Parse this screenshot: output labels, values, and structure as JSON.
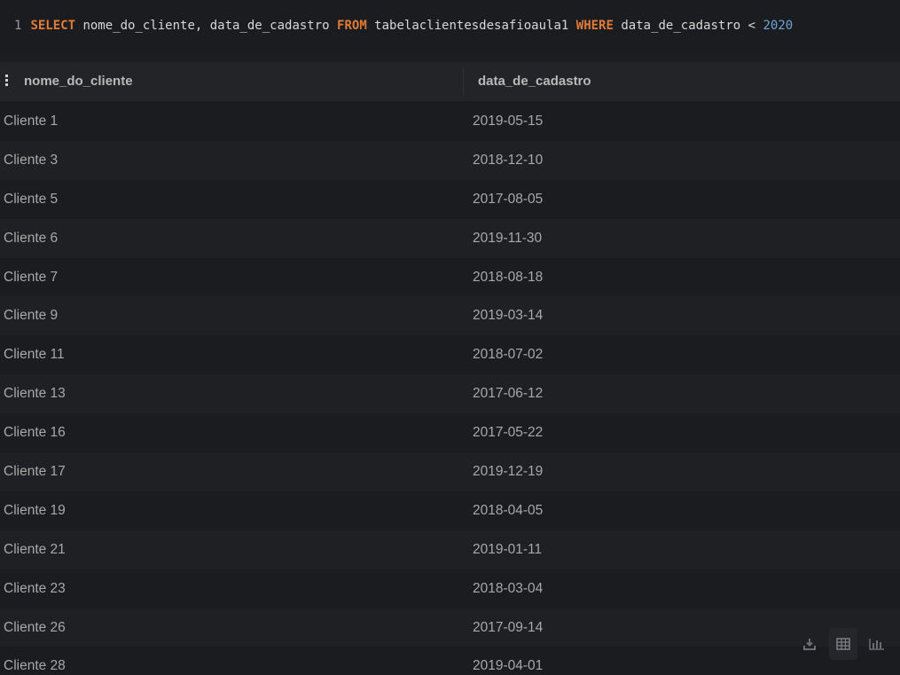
{
  "editor": {
    "line_number": "1",
    "tokens": [
      {
        "type": "kw",
        "text": "SELECT"
      },
      {
        "type": "ident",
        "text": " nome_do_cliente, data_de_cadastro "
      },
      {
        "type": "kw",
        "text": "FROM"
      },
      {
        "type": "ident",
        "text": " tabelaclientesdesafioaula1 "
      },
      {
        "type": "kw",
        "text": "WHERE"
      },
      {
        "type": "ident",
        "text": " data_de_cadastro < "
      },
      {
        "type": "num",
        "text": "2020"
      }
    ]
  },
  "results": {
    "columns": [
      "nome_do_cliente",
      "data_de_cadastro"
    ],
    "rows": [
      [
        "Cliente 1",
        "2019-05-15"
      ],
      [
        "Cliente 3",
        "2018-12-10"
      ],
      [
        "Cliente 5",
        "2017-08-05"
      ],
      [
        "Cliente 6",
        "2019-11-30"
      ],
      [
        "Cliente 7",
        "2018-08-18"
      ],
      [
        "Cliente 9",
        "2019-03-14"
      ],
      [
        "Cliente 11",
        "2018-07-02"
      ],
      [
        "Cliente 13",
        "2017-06-12"
      ],
      [
        "Cliente 16",
        "2017-05-22"
      ],
      [
        "Cliente 17",
        "2019-12-19"
      ],
      [
        "Cliente 19",
        "2018-04-05"
      ],
      [
        "Cliente 21",
        "2019-01-11"
      ],
      [
        "Cliente 23",
        "2018-03-04"
      ],
      [
        "Cliente 26",
        "2017-09-14"
      ],
      [
        "Cliente 28",
        "2019-04-01"
      ]
    ]
  },
  "toolbar": {
    "buttons": [
      {
        "icon": "download-icon",
        "active": false
      },
      {
        "icon": "table-icon",
        "active": true
      },
      {
        "icon": "bar-chart-icon",
        "active": false
      }
    ]
  },
  "colors": {
    "keyword": "#e07b39",
    "number": "#6fa3d8",
    "text": "#a8a8a8",
    "background": "#1b1c1f"
  }
}
